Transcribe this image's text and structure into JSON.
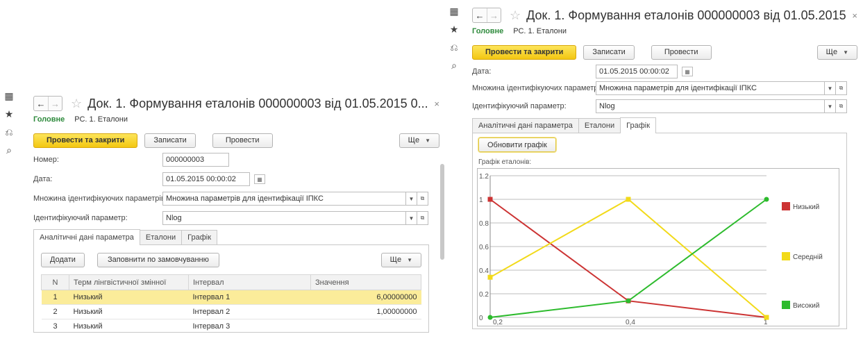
{
  "rail_icons": [
    "apps-grid-icon",
    "favorites-star-icon",
    "history-icon",
    "search-icon"
  ],
  "form": {
    "nav_back": "←",
    "nav_forward": "→",
    "star": "☆",
    "title": "Док. 1. Формування еталонів 000000003 від 01.05.2015 0...",
    "close": "×",
    "breadcrumb_main": "Головне",
    "breadcrumb_register": "РС. 1. Еталони",
    "btn_post_close": "Провести та закрити",
    "btn_save": "Записати",
    "btn_post": "Провести",
    "btn_more": "Ще",
    "label_number": "Номер:",
    "value_number": "000000003",
    "label_date": "Дата:",
    "value_date": "01.05.2015 00:00:02",
    "label_param_set": "Множина ідентифікуючих параметрів:",
    "value_param_set": "Множина параметрів для ідентифікації ІПКС",
    "label_param": "Ідентифікуючий параметр:",
    "value_param": "Nlog",
    "tabs": [
      "Аналітичні дані параметра",
      "Еталони",
      "Графік"
    ]
  },
  "table_panel": {
    "btn_add": "Додати",
    "btn_fill_default": "Заповнити по замовчуванню",
    "btn_more": "Ще",
    "columns": [
      "N",
      "Терм лінгвістичної змінної",
      "Інтервал",
      "Значення"
    ],
    "rows": [
      {
        "n": "1",
        "term": "Низький",
        "interval": "Інтервал 1",
        "value": "6,00000000"
      },
      {
        "n": "2",
        "term": "Низький",
        "interval": "Інтервал 2",
        "value": "1,00000000"
      },
      {
        "n": "3",
        "term": "Низький",
        "interval": "Інтервал 3",
        "value": ""
      }
    ]
  },
  "chart_panel": {
    "btn_refresh": "Обновити графік",
    "chart_label": "Графік еталонів:"
  },
  "colors": {
    "accent_green": "#2e8a3c",
    "primary_yellow": "#f5cc1c",
    "selected_row": "#fbec9a"
  },
  "chart_data": {
    "type": "line",
    "x": [
      "0,2",
      "0,4",
      "1"
    ],
    "ylim": [
      0,
      1.2
    ],
    "yticks": [
      "0",
      "0.2",
      "0.4",
      "0.6",
      "0.8",
      "1",
      "1.2"
    ],
    "legend_position": "right",
    "series": [
      {
        "name": "Низький",
        "color": "#cc3333",
        "values": [
          1,
          0.14,
          0
        ]
      },
      {
        "name": "Середній",
        "color": "#f2da1a",
        "values": [
          0.34,
          1,
          0
        ]
      },
      {
        "name": "Високий",
        "color": "#2dbb2d",
        "values": [
          0,
          0.14,
          1
        ]
      }
    ]
  }
}
